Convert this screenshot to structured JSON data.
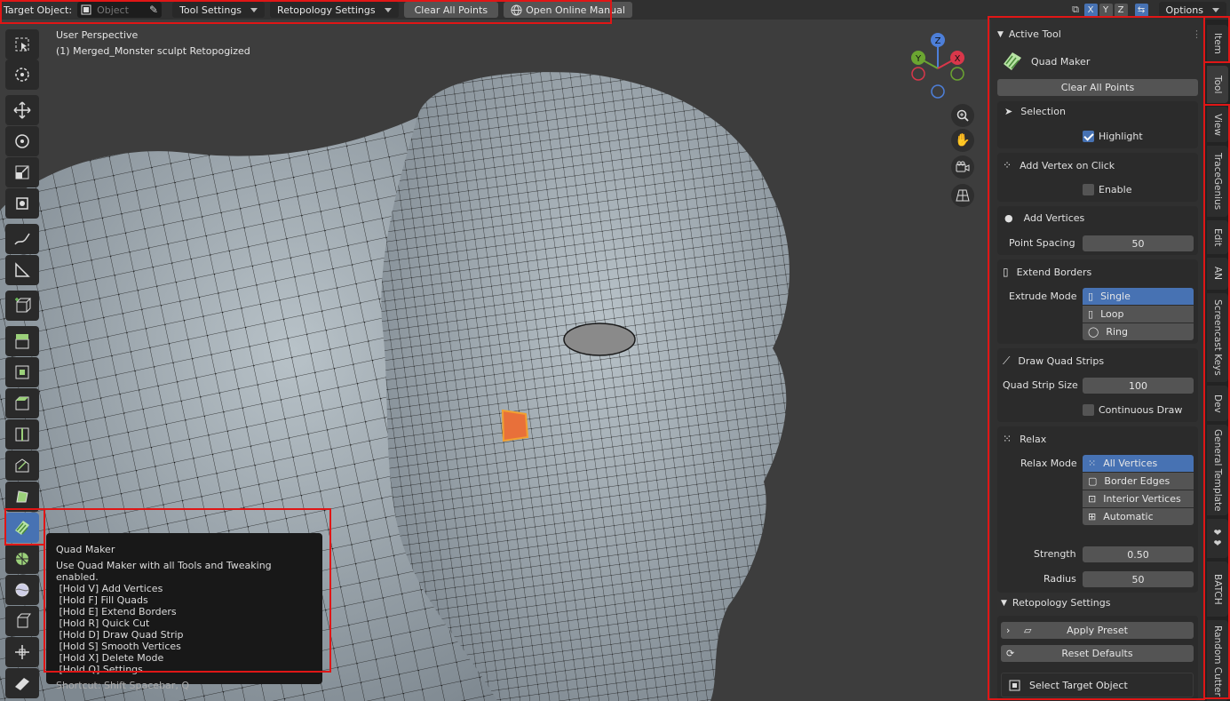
{
  "header": {
    "target_label": "Target Object:",
    "object_placeholder": "Object",
    "tool_settings": "Tool Settings",
    "retopology_settings": "Retopology Settings",
    "clear_all_points": "Clear All Points",
    "open_manual": "Open Online Manual",
    "axis_x": "X",
    "axis_y": "Y",
    "axis_z": "Z",
    "options": "Options"
  },
  "viewport": {
    "perspective": "User Perspective",
    "object_name": "(1) Merged_Monster sculpt Retopogized",
    "gizmo": {
      "z": "Z",
      "y": "Y",
      "x": "X"
    }
  },
  "tooltip": {
    "title": "Quad Maker",
    "lines": [
      "Use Quad Maker with all Tools and Tweaking enabled.",
      " [Hold V] Add Vertices",
      " [Hold F] Fill Quads",
      " [Hold E] Extend Borders",
      " [Hold R] Quick Cut",
      " [Hold D] Draw Quad Strip",
      " [Hold S] Smooth Vertices",
      " [Hold X] Delete Mode",
      " [Hold Q] Settings."
    ],
    "shortcut": "Shortcut: Shift Spacebar, Q"
  },
  "panel": {
    "active_tool": "Active Tool",
    "tool_name": "Quad Maker",
    "clear_all_points": "Clear All Points",
    "selection": {
      "title": "Selection",
      "highlight": "Highlight",
      "highlight_on": true
    },
    "add_vertex_click": {
      "title": "Add Vertex on Click",
      "enable": "Enable",
      "enable_on": false
    },
    "add_vertices": {
      "title": "Add Vertices",
      "spacing_label": "Point Spacing",
      "spacing_value": "50"
    },
    "extend_borders": {
      "title": "Extend Borders",
      "mode_label": "Extrude Mode",
      "modes": [
        "Single",
        "Loop",
        "Ring"
      ],
      "selected": "Single"
    },
    "quad_strips": {
      "title": "Draw Quad Strips",
      "size_label": "Quad Strip Size",
      "size_value": "100",
      "continuous": "Continuous Draw",
      "continuous_on": false
    },
    "relax": {
      "title": "Relax",
      "mode_label": "Relax Mode",
      "modes": [
        "All Vertices",
        "Border Edges",
        "Interior Vertices",
        "Automatic"
      ],
      "selected": "All Vertices",
      "strength_label": "Strength",
      "strength_value": "0.50",
      "radius_label": "Radius",
      "radius_value": "50"
    },
    "retopo": {
      "title": "Retopology Settings",
      "apply_preset": "Apply Preset",
      "reset_defaults": "Reset Defaults",
      "select_target": "Select Target Object"
    }
  },
  "tabs": [
    "Item",
    "Tool",
    "View",
    "TraceGenius",
    "Edit",
    "AN",
    "Screencast Keys",
    "Dev",
    "General Template",
    "❤❤",
    "BATCH",
    "Random Cutter"
  ],
  "colors": {
    "accent": "#4772b3",
    "highlight_box": "#e01616",
    "selected_face": "#e8703a"
  }
}
